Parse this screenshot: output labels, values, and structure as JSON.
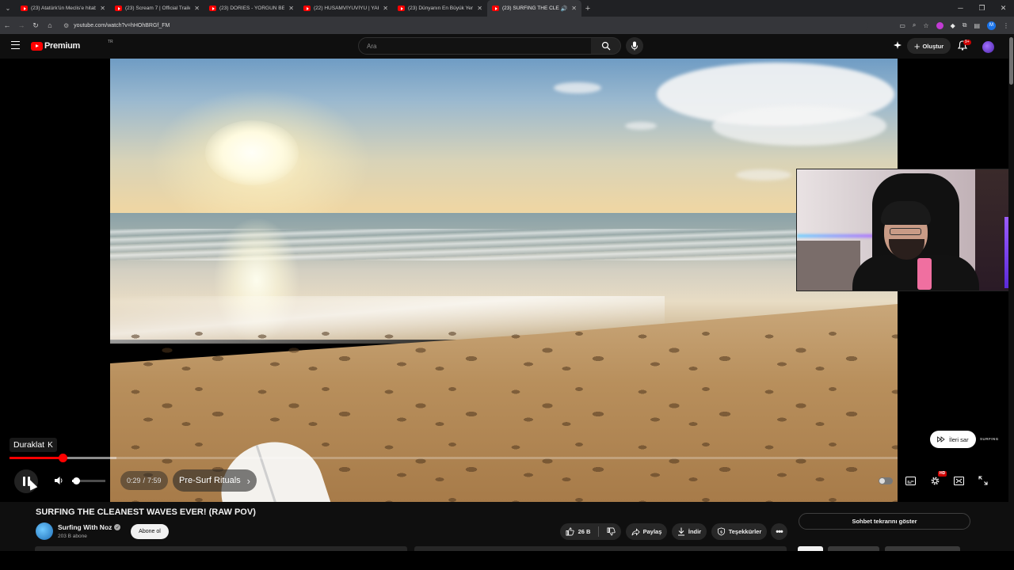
{
  "browser": {
    "tabs": [
      {
        "title": "(23) Atatürk'ün Meclis'e hitabı",
        "active": false
      },
      {
        "title": "(23) Scream 7 | Official Trailer |",
        "active": false
      },
      {
        "title": "(23) DORİES - YORGUN BEDEN",
        "active": false
      },
      {
        "title": "(22) HUSAMVİYUVİYU | YAKIŞI",
        "active": false
      },
      {
        "title": "(23) Dünyanın En Büyük Yerah",
        "active": false
      },
      {
        "title": "(23) SURFING THE CLEANE",
        "active": true
      }
    ],
    "url": "youtube.com/watch?v=hHOhBRGf_FM",
    "profile_initial": "M"
  },
  "header": {
    "logo_text": "Premium",
    "region": "TR",
    "search_placeholder": "Ara",
    "create_label": "Oluştur",
    "notifications_badge": "9+"
  },
  "player": {
    "tooltip_label": "Duraklat",
    "tooltip_key": "K",
    "current_time": "0:29",
    "duration": "7:59",
    "time_separator": "/",
    "chapter": "Pre-Surf Rituals",
    "skip_label": "İleri sar",
    "watermark": "SURFING",
    "hd_badge": "HD",
    "progress_fraction": 0.0605,
    "buffered_fraction": 0.12,
    "volume_fraction": 0.12
  },
  "video": {
    "title": "SURFING THE CLEANEST WAVES EVER! (RAW POV)",
    "channel": "Surfing With Noz",
    "subscribers": "203 B abone",
    "subscribe_label": "Abone ol",
    "likes": "26 B",
    "share_label": "Paylaş",
    "download_label": "İndir",
    "thanks_label": "Teşekkürler",
    "chat_replay_label": "Sohbet tekrarını göster"
  },
  "colors": {
    "accent": "#ff0000",
    "background": "#0f0f0f",
    "button_bg": "#272727"
  }
}
